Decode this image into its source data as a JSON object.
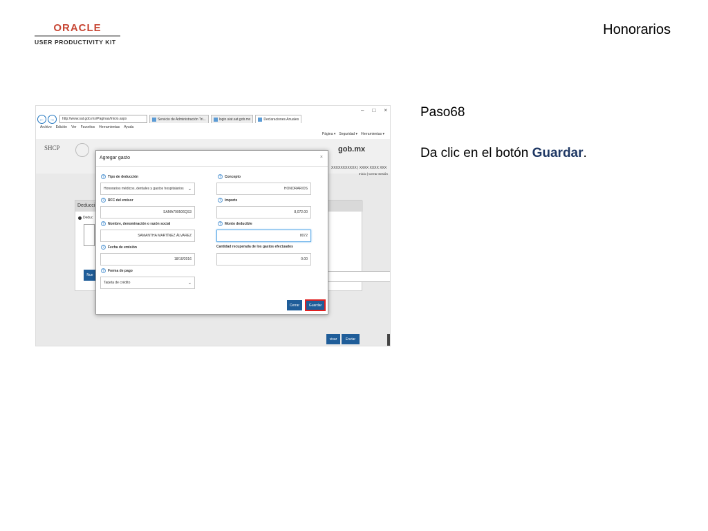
{
  "header": {
    "logo_oracle": "ORACLE",
    "logo_upk": "USER PRODUCTIVITY KIT",
    "topic_title": "Honorarios"
  },
  "instructions": {
    "step_title": "Paso68",
    "text_before": "Da clic en el botón ",
    "text_bold": "Guardar",
    "text_after": "."
  },
  "browser": {
    "window_controls": [
      "–",
      "□",
      "×"
    ],
    "back_icon": "←",
    "forward_icon": "→",
    "address": "http://www.sat.gob.mx/Paginas/Inicio.aspx",
    "tabs": [
      {
        "label": "Servicio de Administración Tri..."
      },
      {
        "label": "login.siat.sat.gob.mx"
      },
      {
        "label": "Declaraciones Anuales"
      }
    ],
    "menu": [
      "Archivo",
      "Edición",
      "Ver",
      "Favoritos",
      "Herramientas",
      "Ayuda"
    ],
    "toolbar": [
      "Página ▾",
      "Seguridad ▾",
      "Herramientas ▾"
    ]
  },
  "site": {
    "shcp": "SHCP",
    "gobmx": "gob.mx",
    "rfc_line": "XXXXXXXXXXX | XXXX XXXX XXX",
    "links_line": "Inicio | Cerrar Sesión",
    "panel_title": "Deducci",
    "radio_label": "Deduc",
    "box2": "0",
    "box3": "700",
    "nuevo_label": "Nue",
    "revisar_label": "visar",
    "enviar_label": "Enviar"
  },
  "modal": {
    "title": "Agregar gasto",
    "close": "×",
    "fields": {
      "tipo_label": "Tipo de deducción",
      "tipo_value": "Honorarios médicos, dentales y gastos hospitalarios",
      "concepto_label": "Concepto",
      "concepto_value": "HONORARIOS",
      "rfc_label": "RFC del emisor",
      "rfc_value": "SAMA790506QS3",
      "importe_label": "Importe",
      "importe_value": "8,072.00",
      "nombre_label": "Nombre, denominación o razón social",
      "nombre_value": "SAMANTHA MARTÍNEZ ÁLVAREZ",
      "monto_label": "Monto deducible",
      "monto_value": "8072",
      "fecha_label": "Fecha de emisión",
      "fecha_value": "18/10/2016",
      "cantidad_label": "Cantidad recuperada de los gastos efectuados",
      "cantidad_value": "0.00",
      "forma_label": "Forma de pago",
      "forma_value": "Tarjeta de crédito"
    },
    "cerrar_label": "Cerrar",
    "guardar_label": "Guardar"
  }
}
